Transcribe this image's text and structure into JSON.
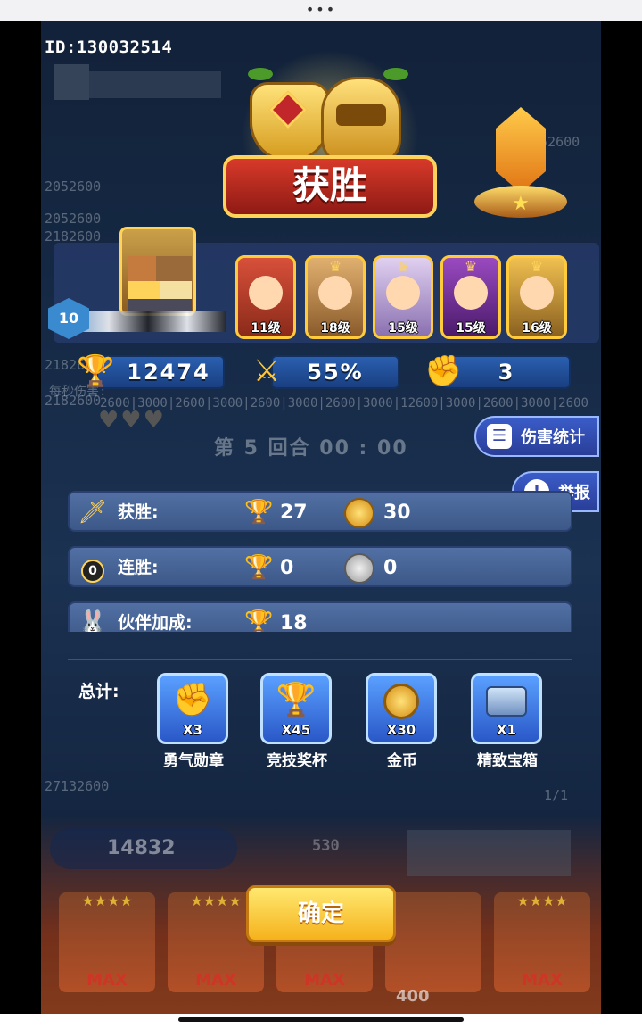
{
  "header": {
    "uid": "ID:130032514"
  },
  "banner": {
    "title": "获胜"
  },
  "player": {
    "level": "10"
  },
  "heroes": [
    {
      "level": "11级",
      "color": "#c8402a"
    },
    {
      "level": "18级",
      "color": "#b88a4a"
    },
    {
      "level": "15级",
      "color": "#c8b0e0"
    },
    {
      "level": "15级",
      "color": "#7a3aa0"
    },
    {
      "level": "16级",
      "color": "#d0a040"
    }
  ],
  "stats": {
    "trophies": "12474",
    "win_rate": "55%",
    "medals": "3"
  },
  "battle": {
    "round": "第 5 回合 00 : 00"
  },
  "side_buttons": {
    "damage_stats": "伤害统计",
    "report": "举报"
  },
  "rewards": [
    {
      "label": "获胜:",
      "trophies": "27",
      "coins": "30"
    },
    {
      "label": "连胜:",
      "badge": "0",
      "trophies": "0",
      "coins": "0"
    },
    {
      "label": "伙伴加成:",
      "trophies": "18"
    }
  ],
  "totals": {
    "label": "总计:",
    "items": [
      {
        "count": "X3",
        "name": "勇气勋章",
        "icon": "medal-icon"
      },
      {
        "count": "X45",
        "name": "竞技奖杯",
        "icon": "trophy-icon"
      },
      {
        "count": "X30",
        "name": "金币",
        "icon": "coin-icon"
      },
      {
        "count": "X1",
        "name": "精致宝箱",
        "icon": "chest-icon"
      }
    ]
  },
  "background": {
    "numbers": [
      "2052600",
      "2052600",
      "2182600",
      "2052600",
      "2182600",
      "2182600",
      "152600",
      "600",
      "27132600"
    ],
    "damage_row": "2600|3000|2600|3000|2600|3000|2600|3000|12600|3000|2600|3000|2600",
    "coin_total": "14832",
    "small_value": "530",
    "page": "1/1",
    "cost": "400",
    "max_label": "MAX",
    "bg_label": "每秒伤害:"
  },
  "actions": {
    "confirm": "确定"
  },
  "colors": {
    "accent": "#ffd35a",
    "banner": "#d83a2a",
    "panel": "#3c5888"
  }
}
